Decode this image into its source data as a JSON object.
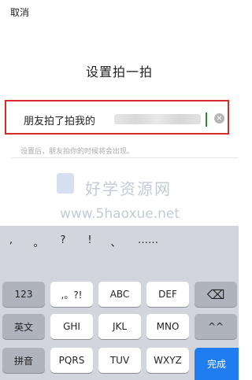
{
  "header": {
    "cancel_label": "取消",
    "title": "设置拍一拍"
  },
  "input": {
    "value": "朋友拍了拍我的",
    "clear_icon": "×"
  },
  "hint": "设置后，朋友拍你的时候将会出现。",
  "watermark": {
    "line1": "好学资源网",
    "line2": "www.5haoxue.net"
  },
  "keyboard": {
    "punctuation": [
      ",",
      "。",
      "?",
      "!",
      "、",
      "……"
    ],
    "rows": [
      {
        "left": "123",
        "keys": [
          ",。?!",
          "ABC",
          "DEF"
        ],
        "right": "⌫"
      },
      {
        "left": "英文",
        "keys": [
          "GHI",
          "JKL",
          "MNO"
        ],
        "right": "^^"
      },
      {
        "left": "拼音",
        "keys": [
          "PQRS",
          "TUV",
          "WXYZ"
        ],
        "right": "完成"
      }
    ]
  }
}
